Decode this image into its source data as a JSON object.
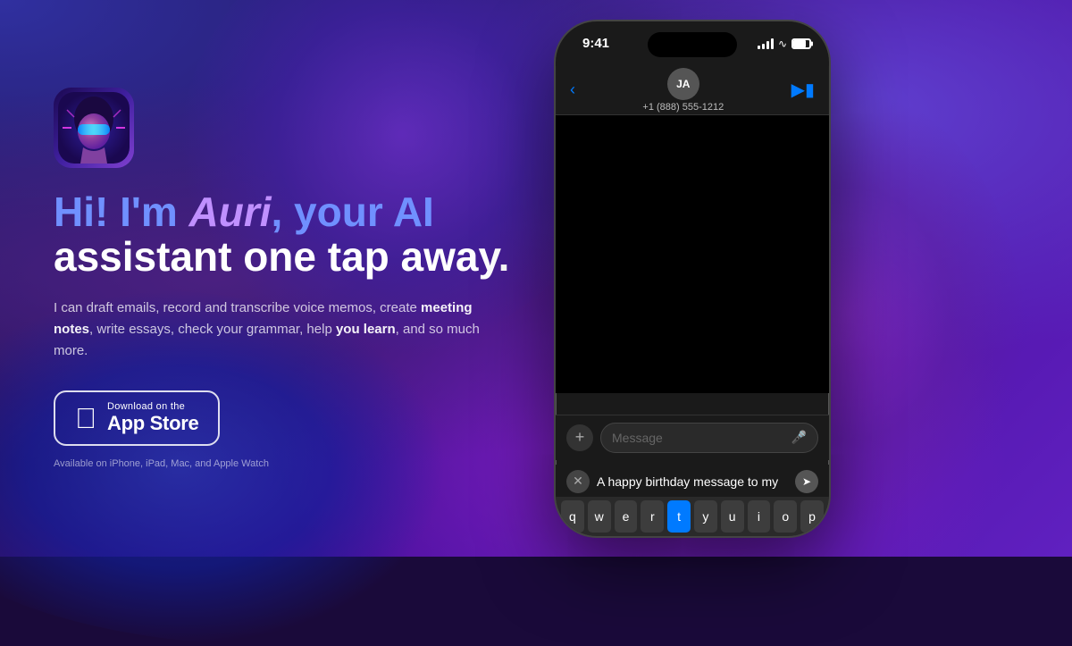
{
  "background": {
    "gradient_desc": "dark purple-blue abstract background"
  },
  "left": {
    "app_icon_alt": "Auri AI App Icon",
    "headline_part1": "Hi! I'm ",
    "headline_auri": "Auri",
    "headline_part2": ", your AI",
    "headline_part3": "assistant one tap away.",
    "description_part1": "I can draft emails, record and transcribe voice memos, create ",
    "description_bold1": "meeting notes",
    "description_part2": ", write essays, check your grammar, help ",
    "description_bold2": "you learn",
    "description_part3": ", and so much more.",
    "app_store_small": "Download on the",
    "app_store_large": "App Store",
    "available": "Available on iPhone, iPad, Mac, and Apple Watch"
  },
  "iphone": {
    "status_time": "9:41",
    "contact_initials": "JA",
    "contact_phone": "+1 (888) 555-1212",
    "message_placeholder": "Message",
    "ai_prompt_text": "A happy birthday message to my",
    "keyboard_row1": [
      "q",
      "w",
      "e",
      "r",
      "t",
      "y",
      "u",
      "i",
      "o",
      "p"
    ],
    "active_key": "t"
  }
}
